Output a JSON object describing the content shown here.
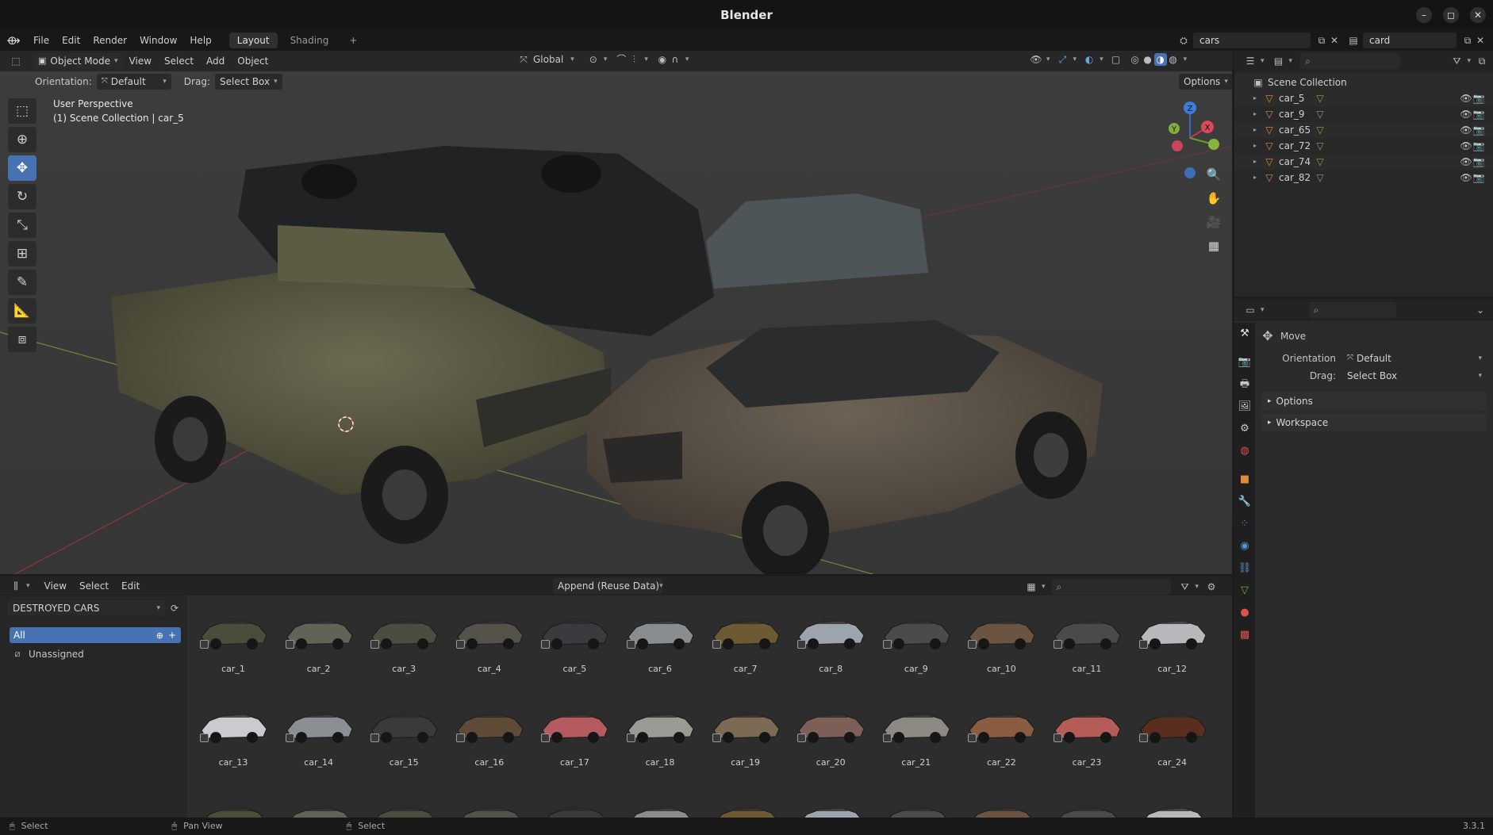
{
  "app": {
    "title": "Blender",
    "version": "3.3.1"
  },
  "topbar": {
    "menus": [
      "File",
      "Edit",
      "Render",
      "Window",
      "Help"
    ],
    "workspaces": [
      "Layout",
      "Shading"
    ],
    "active_workspace": "Layout",
    "add_workspace": "+",
    "scene_name": "cars",
    "view_layer": "card"
  },
  "viewport": {
    "mode": "Object Mode",
    "menus": [
      "View",
      "Select",
      "Add",
      "Object"
    ],
    "transform_orientation": "Global",
    "orientation_label": "Orientation:",
    "orientation_value": "Default",
    "drag_label": "Drag:",
    "drag_value": "Select Box",
    "options_label": "Options",
    "overlay_line1": "User Perspective",
    "overlay_line2": "(1) Scene Collection | car_5",
    "gizmo": {
      "x": "X",
      "y": "Y",
      "z": "Z"
    }
  },
  "outliner": {
    "root": "Scene Collection",
    "items": [
      "car_5",
      "car_9",
      "car_65",
      "car_72",
      "car_74",
      "car_82"
    ]
  },
  "properties": {
    "tool_title": "Move",
    "orientation_label": "Orientation",
    "orientation_value": "Default",
    "drag_label": "Drag:",
    "drag_value": "Select Box",
    "panels": [
      "Options",
      "Workspace"
    ]
  },
  "asset_browser": {
    "menus": [
      "View",
      "Select",
      "Edit"
    ],
    "import_method": "Append (Reuse Data)",
    "library": "DESTROYED CARS",
    "catalogs": [
      "All",
      "Unassigned"
    ],
    "assets": [
      "car_1",
      "car_2",
      "car_3",
      "car_4",
      "car_5",
      "car_6",
      "car_7",
      "car_8",
      "car_9",
      "car_10",
      "car_11",
      "car_12",
      "car_13",
      "car_14",
      "car_15",
      "car_16",
      "car_17",
      "car_18",
      "car_19",
      "car_20",
      "car_21",
      "car_22",
      "car_23",
      "car_24"
    ],
    "asset_colors": [
      "#4a4d3a",
      "#5f6358",
      "#4d4c40",
      "#55524c",
      "#3b3b3f",
      "#8a8d90",
      "#6d5a32",
      "#9ea4ad",
      "#4b4b4e",
      "#6b5442",
      "#4a4a4c",
      "#b8b8bc",
      "#c9cbcf",
      "#8b8e93",
      "#3a3a3c",
      "#5e4a36",
      "#b55a5e",
      "#9b9b96",
      "#7c6a55",
      "#7c6058",
      "#8d8a84",
      "#8a5c42",
      "#b45c58",
      "#5a2e1e"
    ]
  },
  "statusbar": {
    "items": [
      "Select",
      "Pan View",
      "Select"
    ]
  },
  "colors": {
    "accent": "#4772b3",
    "panel_bg": "#2b2b2b",
    "viewport_bg": "#3b3b3b"
  }
}
